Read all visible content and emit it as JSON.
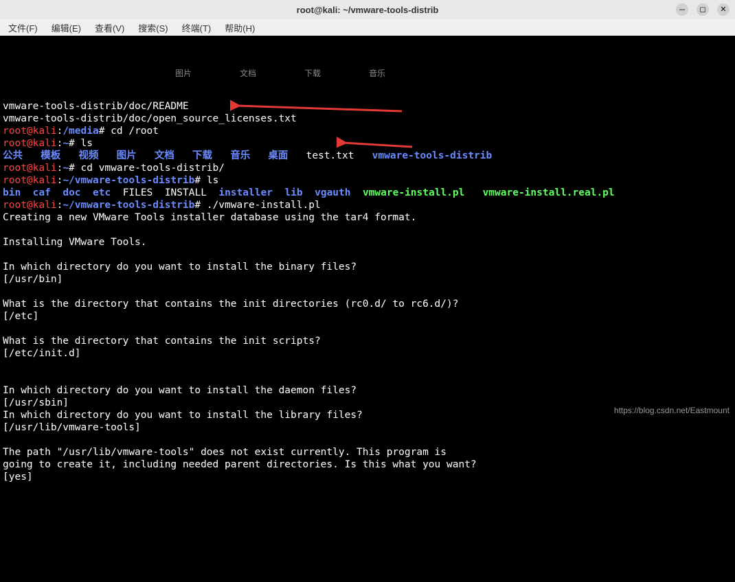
{
  "window": {
    "title": "root@kali: ~/vmware-tools-distrib"
  },
  "menu": {
    "file": "文件(F)",
    "edit": "编辑(E)",
    "view": "查看(V)",
    "search": "搜索(S)",
    "terminal": "终端(T)",
    "help": "帮助(H)"
  },
  "background_icons": {
    "pictures": "图片",
    "documents": "文档",
    "downloads": "下载",
    "music": "音乐"
  },
  "lines": {
    "l1": "vmware-tools-distrib/doc/README",
    "l2": "vmware-tools-distrib/doc/open_source_licenses.txt",
    "l3_user": "root@kali",
    "l3_path": "/media",
    "l3_cmd": "# cd /root",
    "l4_user": "root@kali",
    "l4_path": "~",
    "l4_cmd": "# ls",
    "l5_public": "公共",
    "l5_templates": "模板",
    "l5_video": "视频",
    "l5_pictures": "图片",
    "l5_documents": "文档",
    "l5_downloads": "下载",
    "l5_music": "音乐",
    "l5_desktop": "桌面",
    "l5_test": "test.txt",
    "l5_vmw": "vmware-tools-distrib",
    "l6_user": "root@kali",
    "l6_path": "~",
    "l6_cmd": "# cd vmware-tools-distrib/",
    "l7_user": "root@kali",
    "l7_path": "~/vmware-tools-distrib",
    "l7_cmd": "# ls",
    "l8_bin": "bin",
    "l8_caf": "caf",
    "l8_doc": "doc",
    "l8_etc": "etc",
    "l8_files": "FILES",
    "l8_install": "INSTALL",
    "l8_installer": "installer",
    "l8_lib": "lib",
    "l8_vgauth": "vgauth",
    "l8_vmwinstall": "vmware-install.pl",
    "l8_vmwinstallreal": "vmware-install.real.pl",
    "l9_user": "root@kali",
    "l9_path": "~/vmware-tools-distrib",
    "l9_cmd": "# ./vmware-install.pl",
    "l10": "Creating a new VMware Tools installer database using the tar4 format.",
    "l11": "",
    "l12": "Installing VMware Tools.",
    "l13": "",
    "l14": "In which directory do you want to install the binary files?",
    "l15": "[/usr/bin]",
    "l16": "",
    "l17": "What is the directory that contains the init directories (rc0.d/ to rc6.d/)?",
    "l18": "[/etc]",
    "l19": "",
    "l20": "What is the directory that contains the init scripts?",
    "l21": "[/etc/init.d]",
    "l22": "",
    "l23": "",
    "l24": "In which directory do you want to install the daemon files?",
    "l25": "[/usr/sbin]",
    "l26": "In which directory do you want to install the library files?",
    "l27": "[/usr/lib/vmware-tools]",
    "l28": "",
    "l29": "The path \"/usr/lib/vmware-tools\" does not exist currently. This program is",
    "l30": "going to create it, including needed parent directories. Is this what you want?",
    "l31": "[yes]"
  },
  "watermark": "https://blog.csdn.net/Eastmount"
}
